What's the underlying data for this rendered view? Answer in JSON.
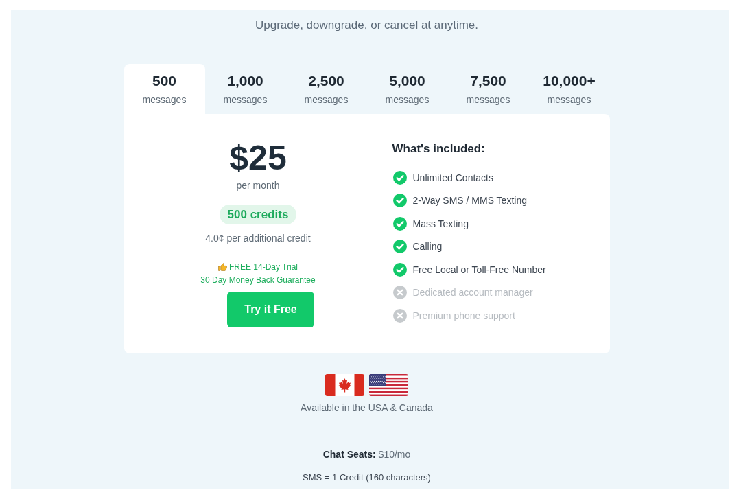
{
  "subtitle": "Upgrade, downgrade, or cancel at anytime.",
  "tabs": [
    {
      "count": "500",
      "label": "messages",
      "selected": true
    },
    {
      "count": "1,000",
      "label": "messages",
      "selected": false
    },
    {
      "count": "2,500",
      "label": "messages",
      "selected": false
    },
    {
      "count": "5,000",
      "label": "messages",
      "selected": false
    },
    {
      "count": "7,500",
      "label": "messages",
      "selected": false
    },
    {
      "count": "10,000+",
      "label": "messages",
      "selected": false
    }
  ],
  "plan": {
    "price": "$25",
    "period": "per month",
    "credits": "500 credits",
    "additional": "4.0¢ per additional credit",
    "trial": "FREE 14-Day Trial",
    "guarantee": "30 Day Money Back Guarantee",
    "cta": "Try it Free"
  },
  "included": {
    "title": "What's included:",
    "features": [
      {
        "label": "Unlimited Contacts",
        "included": true
      },
      {
        "label": "2-Way SMS / MMS Texting",
        "included": true
      },
      {
        "label": "Mass Texting",
        "included": true
      },
      {
        "label": "Calling",
        "included": true
      },
      {
        "label": "Free Local or Toll-Free Number",
        "included": true
      },
      {
        "label": "Dedicated account manager",
        "included": false
      },
      {
        "label": "Premium phone support",
        "included": false
      }
    ]
  },
  "availability": "Available in the USA & Canada",
  "chat_seats": "**Chat Seats:** $10/mo",
  "sms_note": "SMS = 1 Credit (160 characters)"
}
